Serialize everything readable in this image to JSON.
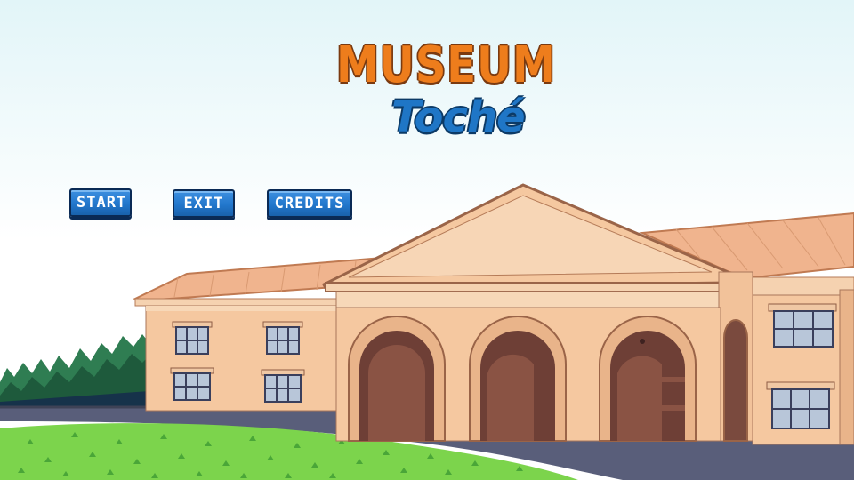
{
  "game": {
    "title_line1": "MUSEUM",
    "title_line2": "Toché"
  },
  "menu": {
    "start_label": "START",
    "exit_label": "EXIT",
    "credits_label": "CREDITS"
  },
  "colors": {
    "sky_top": "#e2f5f8",
    "title_orange": "#ee7d1c",
    "title_blue": "#1f76c6",
    "button_blue": "#2277cc",
    "wall": "#f5c8a0",
    "roof": "#f0b48e",
    "arch_interior": "#6e3f36",
    "grass": "#7cd44c",
    "road": "#595e7a"
  }
}
